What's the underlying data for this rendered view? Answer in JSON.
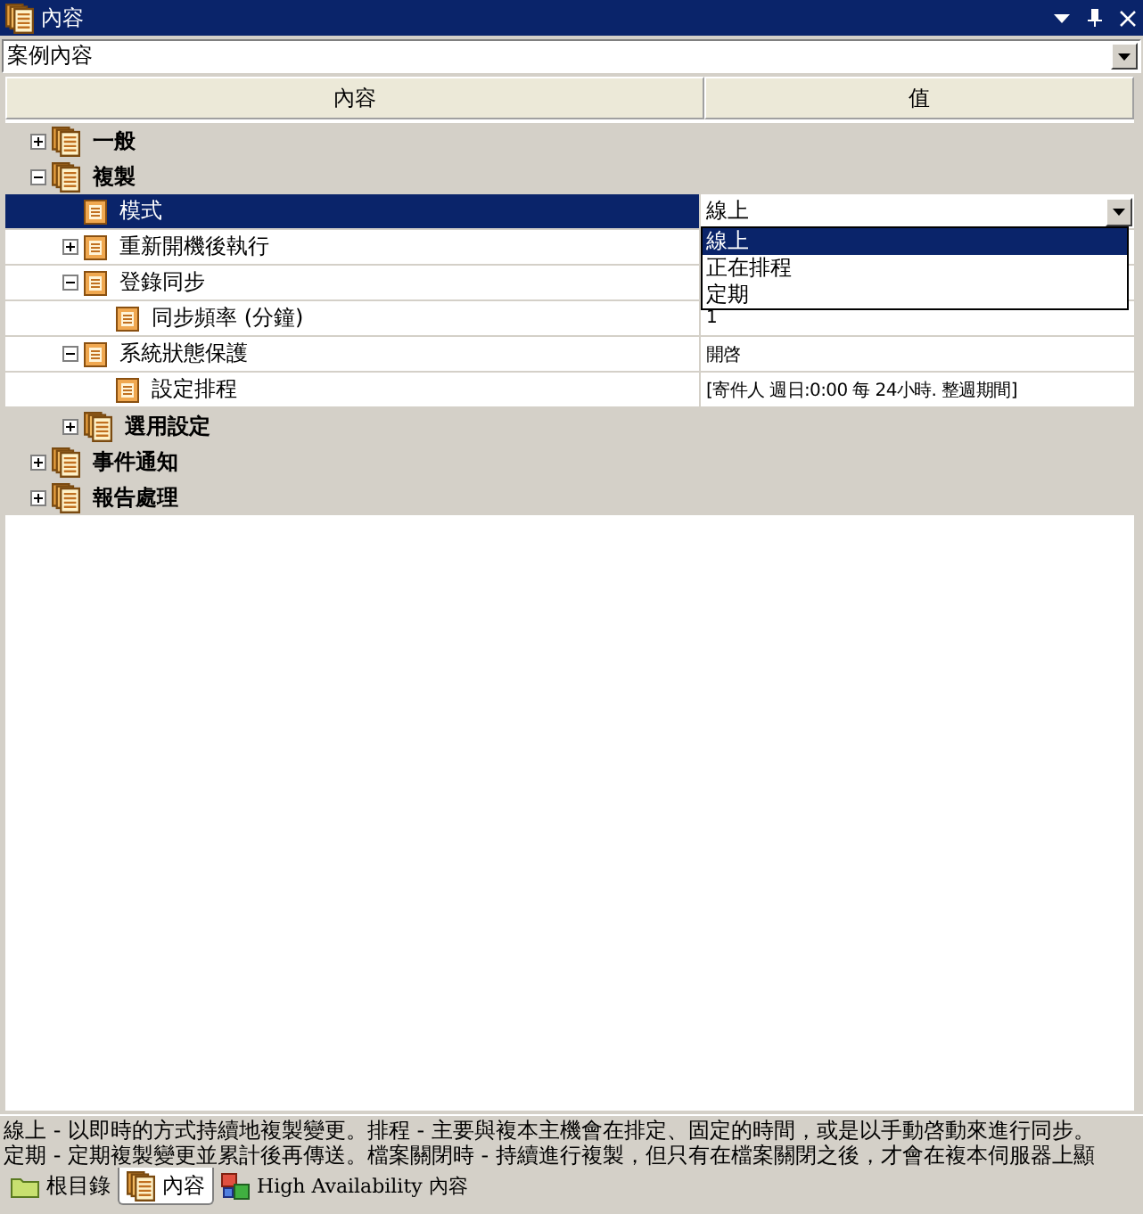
{
  "window": {
    "title": "內容"
  },
  "selector": {
    "value": "案例內容"
  },
  "grid": {
    "columns": [
      "內容",
      "值"
    ],
    "rows": [
      {
        "kind": "category",
        "label": "一般",
        "expanded": false,
        "selected": false
      },
      {
        "kind": "category",
        "label": "複製",
        "expanded": true,
        "selected": false,
        "children": [
          {
            "kind": "property",
            "label": "模式",
            "selected": true,
            "value": "線上",
            "editor": {
              "options": [
                {
                  "label": "線上",
                  "selected": true
                },
                {
                  "label": "正在排程",
                  "selected": false
                },
                {
                  "label": "定期",
                  "selected": false
                }
              ]
            }
          },
          {
            "kind": "property",
            "label": "重新開機後執行",
            "expanded": false,
            "selected": false
          },
          {
            "kind": "property",
            "label": "登錄同步",
            "expanded": true,
            "selected": false,
            "children": [
              {
                "kind": "property",
                "label": "同步頻率 (分鐘)",
                "selected": false,
                "value": "1"
              }
            ]
          },
          {
            "kind": "property",
            "label": "系統狀態保護",
            "expanded": true,
            "selected": false,
            "value": "開啓",
            "children": [
              {
                "kind": "property",
                "label": "設定排程",
                "selected": false,
                "value": "[寄件人 週日:0:00 每 24小時. 整週期間]"
              }
            ]
          },
          {
            "kind": "category",
            "label": "選用設定",
            "expanded": false,
            "selected": false
          }
        ]
      },
      {
        "kind": "category",
        "label": "事件通知",
        "expanded": false,
        "selected": false
      },
      {
        "kind": "category",
        "label": "報告處理",
        "expanded": false,
        "selected": false
      }
    ]
  },
  "description": [
    "線上 - 以即時的方式持續地複製變更。排程 - 主要與複本主機會在排定、固定的時間，或是以手動啓動來進行同步。",
    "定期 - 定期複製變更並累計後再傳送。檔案關閉時 - 持續進行複製，但只有在檔案關閉之後，才會在複本伺服器上顯"
  ],
  "tabs": [
    {
      "label": "根目錄",
      "kind": "folder",
      "selected": false
    },
    {
      "label": "內容",
      "kind": "pages",
      "selected": true
    },
    {
      "label": "High Availability 內容",
      "kind": "network",
      "selected": false
    }
  ]
}
